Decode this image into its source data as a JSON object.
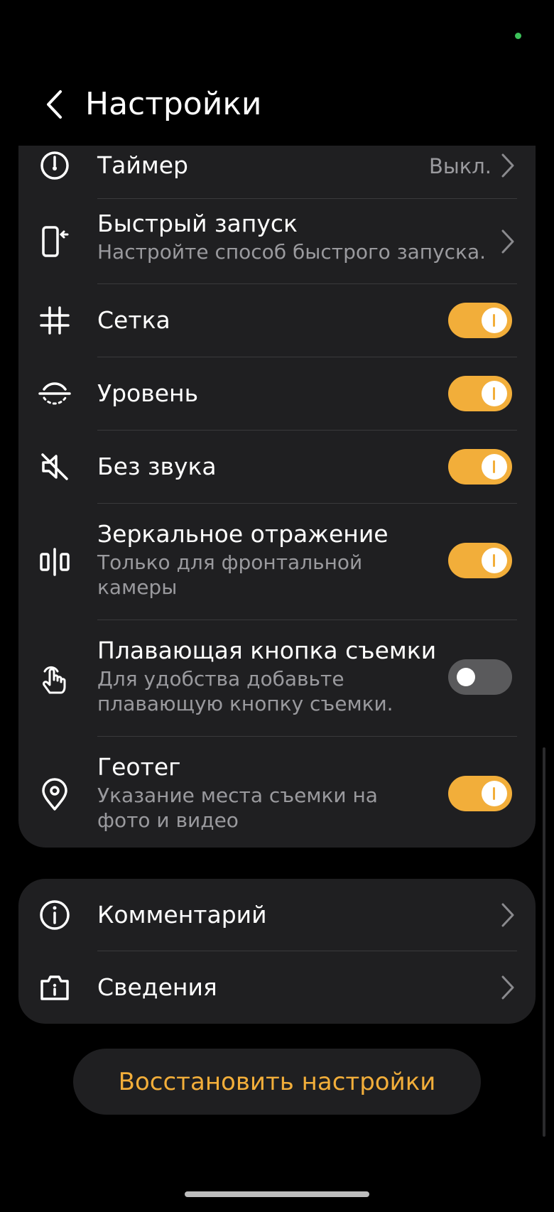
{
  "header": {
    "title": "Настройки",
    "back_icon": "chevron-left-icon"
  },
  "settings": {
    "timer": {
      "label": "Таймер",
      "value": "Выкл.",
      "icon": "timer-icon"
    },
    "quick_launch": {
      "label": "Быстрый запуск",
      "sub": "Настройте способ быстрого запуска.",
      "icon": "phone-quick-launch-icon"
    },
    "grid": {
      "label": "Сетка",
      "enabled": true,
      "icon": "grid-hash-icon"
    },
    "level": {
      "label": "Уровень",
      "enabled": true,
      "icon": "level-icon"
    },
    "mute": {
      "label": "Без звука",
      "enabled": true,
      "icon": "speaker-muted-icon"
    },
    "mirror": {
      "label": "Зеркальное отражение",
      "sub": "Только для фронтальной камеры",
      "enabled": true,
      "icon": "mirror-icon"
    },
    "floating_shutter": {
      "label": "Плавающая кнопка съемки",
      "sub": "Для удобства добавьте плавающую кнопку съемки.",
      "enabled": false,
      "icon": "touch-hand-icon"
    },
    "geotag": {
      "label": "Геотег",
      "sub": "Указание места съемки на фото и видео",
      "enabled": true,
      "icon": "location-pin-icon"
    }
  },
  "about": {
    "feedback": {
      "label": "Комментарий",
      "icon": "info-circle-icon"
    },
    "info": {
      "label": "Сведения",
      "icon": "camera-info-icon"
    }
  },
  "reset_button": "Восстановить настройки",
  "colors": {
    "accent": "#f2ae3a",
    "card": "#1f1f21",
    "background": "#000000",
    "secondary_text": "#9a9a9e"
  }
}
